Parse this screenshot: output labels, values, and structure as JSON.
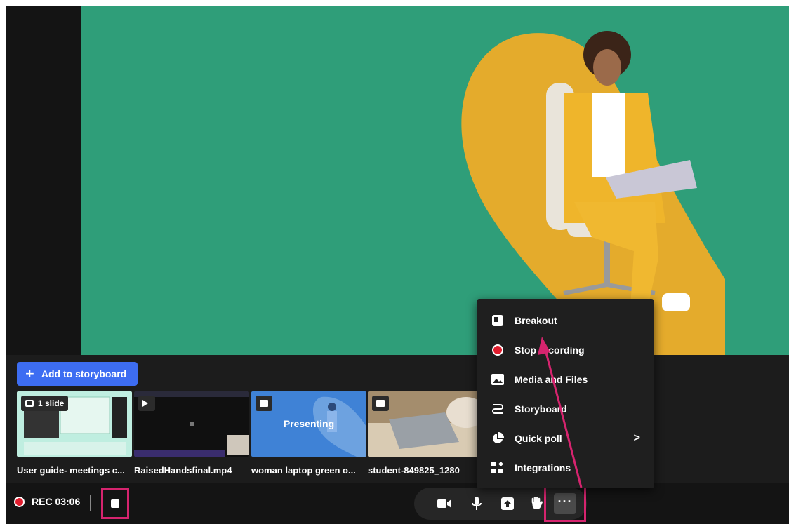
{
  "storyboard": {
    "add_label": "Add to storyboard",
    "items": [
      {
        "caption": "User guide- meetings c...",
        "badge": "1 slide",
        "type": "slides"
      },
      {
        "caption": "RaisedHandsfinal.mp4",
        "type": "video"
      },
      {
        "caption": "woman laptop green o...",
        "type": "image",
        "overlay": "Presenting"
      },
      {
        "caption": "student-849825_1280",
        "type": "image"
      }
    ]
  },
  "menu": {
    "items": [
      {
        "label": "Breakout",
        "icon": "breakout-icon"
      },
      {
        "label": "Stop recording",
        "icon": "record-icon"
      },
      {
        "label": "Media and Files",
        "icon": "image-icon"
      },
      {
        "label": "Storyboard",
        "icon": "storyboard-icon"
      },
      {
        "label": "Quick poll",
        "icon": "pie-chart-icon",
        "submenu": ">"
      },
      {
        "label": "Integrations",
        "icon": "integrations-icon"
      }
    ]
  },
  "controls": {
    "rec_label": "REC 03:06",
    "more_label": "···",
    "buttons": [
      "camera-icon",
      "microphone-icon",
      "share-upload-icon",
      "raise-hand-icon"
    ]
  },
  "colors": {
    "accent": "#3d6df2",
    "stage_green": "#2f9e79",
    "highlight": "#d6246e",
    "record_red": "#e11d2e"
  }
}
